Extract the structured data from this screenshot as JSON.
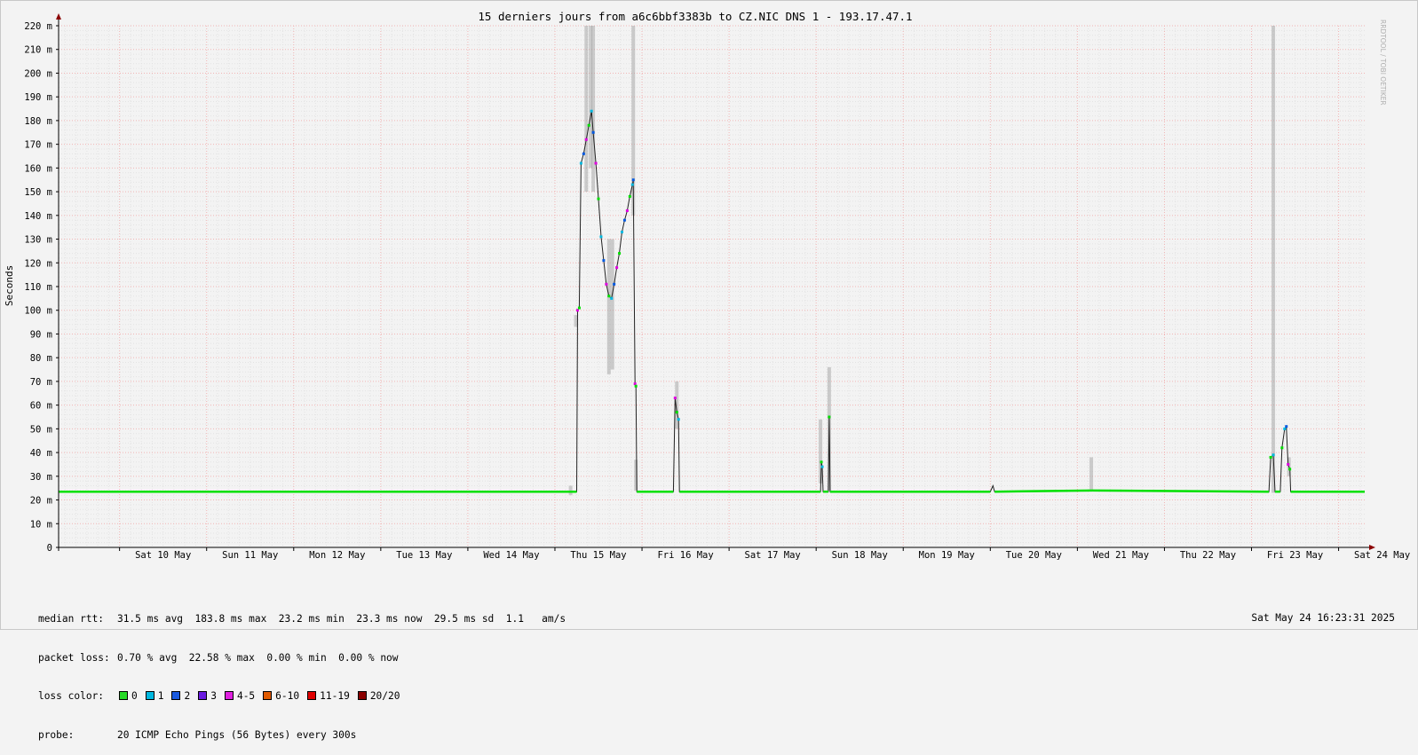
{
  "chart_data": {
    "type": "line",
    "title": "15 derniers jours from a6c6bbf3383b to CZ.NIC DNS 1 - 193.17.47.1",
    "ylabel": "Seconds",
    "watermark": "RRDTOOL / TOBI OETIKER",
    "ylim": [
      0,
      220
    ],
    "y_unit_suffix": "m",
    "y_ticks": [
      "0",
      "10 m",
      "20 m",
      "30 m",
      "40 m",
      "50 m",
      "60 m",
      "70 m",
      "80 m",
      "90 m",
      "100 m",
      "110 m",
      "120 m",
      "130 m",
      "140 m",
      "150 m",
      "160 m",
      "170 m",
      "180 m",
      "190 m",
      "200 m",
      "210 m",
      "220 m"
    ],
    "x_range_days": [
      9.3,
      24.3
    ],
    "x_ticks": [
      {
        "day": 10,
        "label": "Sat 10 May"
      },
      {
        "day": 11,
        "label": "Sun 11 May"
      },
      {
        "day": 12,
        "label": "Mon 12 May"
      },
      {
        "day": 13,
        "label": "Tue 13 May"
      },
      {
        "day": 14,
        "label": "Wed 14 May"
      },
      {
        "day": 15,
        "label": "Thu 15 May"
      },
      {
        "day": 16,
        "label": "Fri 16 May"
      },
      {
        "day": 17,
        "label": "Sat 17 May"
      },
      {
        "day": 18,
        "label": "Sun 18 May"
      },
      {
        "day": 19,
        "label": "Mon 19 May"
      },
      {
        "day": 20,
        "label": "Tue 20 May"
      },
      {
        "day": 21,
        "label": "Wed 21 May"
      },
      {
        "day": 22,
        "label": "Thu 22 May"
      },
      {
        "day": 23,
        "label": "Fri 23 May"
      },
      {
        "day": 24,
        "label": "Sat 24 May"
      }
    ],
    "grid": true,
    "series": [
      {
        "name": "median rtt",
        "points": [
          [
            9.3,
            23.5
          ],
          [
            15.25,
            23.5
          ],
          [
            15.26,
            100
          ],
          [
            15.28,
            101
          ],
          [
            15.3,
            162
          ],
          [
            15.33,
            166
          ],
          [
            15.36,
            172
          ],
          [
            15.39,
            178
          ],
          [
            15.42,
            184
          ],
          [
            15.44,
            175
          ],
          [
            15.47,
            162
          ],
          [
            15.5,
            147
          ],
          [
            15.53,
            131
          ],
          [
            15.56,
            121
          ],
          [
            15.59,
            111
          ],
          [
            15.62,
            106
          ],
          [
            15.65,
            105
          ],
          [
            15.68,
            111
          ],
          [
            15.71,
            118
          ],
          [
            15.74,
            124
          ],
          [
            15.77,
            133
          ],
          [
            15.8,
            138
          ],
          [
            15.83,
            142
          ],
          [
            15.86,
            148
          ],
          [
            15.89,
            153
          ],
          [
            15.9,
            155
          ],
          [
            15.92,
            69
          ],
          [
            15.93,
            68
          ],
          [
            15.94,
            23.5
          ],
          [
            16.36,
            23.5
          ],
          [
            16.38,
            63
          ],
          [
            16.4,
            57
          ],
          [
            16.42,
            54
          ],
          [
            16.43,
            23.5
          ],
          [
            18.05,
            23.5
          ],
          [
            18.06,
            36
          ],
          [
            18.07,
            34
          ],
          [
            18.08,
            23.5
          ],
          [
            18.14,
            23.5
          ],
          [
            18.15,
            55
          ],
          [
            18.16,
            23.5
          ],
          [
            20.0,
            23.5
          ],
          [
            20.03,
            26
          ],
          [
            20.05,
            23.5
          ],
          [
            21.17,
            24
          ],
          [
            21.18,
            24
          ],
          [
            23.2,
            23.5
          ],
          [
            23.22,
            38
          ],
          [
            23.25,
            39
          ],
          [
            23.27,
            23.5
          ],
          [
            23.33,
            23.5
          ],
          [
            23.35,
            42
          ],
          [
            23.38,
            50
          ],
          [
            23.4,
            51
          ],
          [
            23.42,
            35
          ],
          [
            23.44,
            33
          ],
          [
            23.45,
            23.5
          ],
          [
            24.3,
            23.5
          ]
        ]
      }
    ],
    "smoke_spikes": [
      {
        "day": 15.18,
        "ymin": 22,
        "ymax": 26
      },
      {
        "day": 15.24,
        "ymin": 93,
        "ymax": 98
      },
      {
        "day": 15.36,
        "ymin": 150,
        "ymax": 220
      },
      {
        "day": 15.41,
        "ymin": 160,
        "ymax": 220
      },
      {
        "day": 15.44,
        "ymin": 150,
        "ymax": 220
      },
      {
        "day": 15.62,
        "ymin": 73,
        "ymax": 130
      },
      {
        "day": 15.66,
        "ymin": 75,
        "ymax": 130
      },
      {
        "day": 15.9,
        "ymin": 140,
        "ymax": 220
      },
      {
        "day": 15.93,
        "ymin": 24,
        "ymax": 37
      },
      {
        "day": 16.4,
        "ymin": 50,
        "ymax": 70
      },
      {
        "day": 18.05,
        "ymin": 27,
        "ymax": 54
      },
      {
        "day": 18.15,
        "ymin": 24,
        "ymax": 76
      },
      {
        "day": 21.16,
        "ymin": 24,
        "ymax": 38
      },
      {
        "day": 23.25,
        "ymin": 23,
        "ymax": 220
      },
      {
        "day": 23.43,
        "ymin": 30,
        "ymax": 38
      }
    ],
    "loss_colors": [
      "#00e000",
      "#00b8e0",
      "#0058e0",
      "#5000e0",
      "#e000e0",
      "#e05800",
      "#e00000",
      "#880000"
    ]
  },
  "legend": {
    "median_label": "median rtt:",
    "median_text": "31.5 ms avg  183.8 ms max  23.2 ms min  23.3 ms now  29.5 ms sd  1.1   am/s",
    "loss_label": "packet loss:",
    "loss_text": "0.70 % avg  22.58 % max  0.00 % min  0.00 % now",
    "color_label": "loss color:",
    "colors": [
      {
        "label": "0",
        "color": "#26d926"
      },
      {
        "label": "1",
        "color": "#00b8e0"
      },
      {
        "label": "2",
        "color": "#1a5ae0"
      },
      {
        "label": "3",
        "color": "#6a1ae0"
      },
      {
        "label": "4-5",
        "color": "#e020e0"
      },
      {
        "label": "6-10",
        "color": "#e05a00"
      },
      {
        "label": "11-19",
        "color": "#e00000"
      },
      {
        "label": "20/20",
        "color": "#8a0000"
      }
    ],
    "probe_label": "probe:",
    "probe_text": "20 ICMP Echo Pings (56 Bytes) every 300s"
  },
  "timestamp": "Sat May 24 16:23:31 2025"
}
